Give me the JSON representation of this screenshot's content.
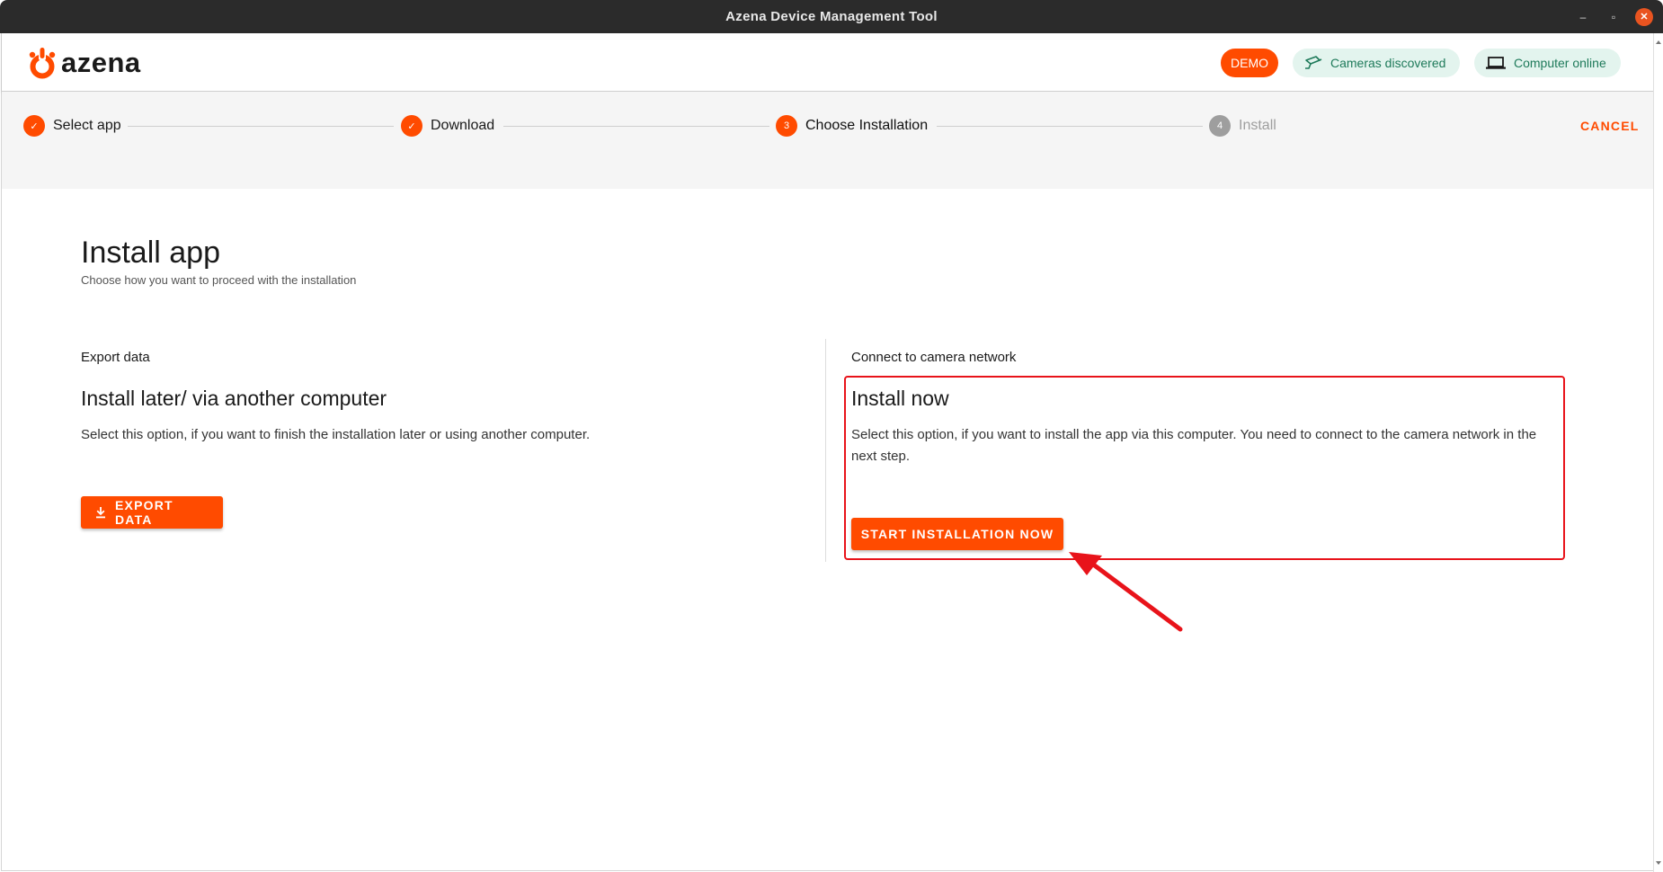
{
  "window": {
    "title": "Azena Device Management Tool",
    "minimize": "–",
    "maximize": "▫",
    "close": "✕"
  },
  "header": {
    "logo_text": "azena",
    "chips": {
      "demo": "DEMO",
      "cameras": "Cameras discovered",
      "computer": "Computer online"
    }
  },
  "stepper": {
    "steps": [
      {
        "label": "Select app",
        "state": "done",
        "marker": "✓"
      },
      {
        "label": "Download",
        "state": "done",
        "marker": "✓"
      },
      {
        "label": "Choose Installation",
        "state": "active",
        "marker": "3"
      },
      {
        "label": "Install",
        "state": "pending",
        "marker": "4"
      }
    ],
    "cancel_label": "CANCEL"
  },
  "page": {
    "title": "Install app",
    "subtitle": "Choose how you want to proceed with the installation"
  },
  "options": {
    "export": {
      "eyebrow": "Export data",
      "heading": "Install later/ via another computer",
      "description": "Select this option, if you want to finish the installation later or using another computer.",
      "button_label": "EXPORT DATA"
    },
    "install": {
      "eyebrow": "Connect to camera network",
      "heading": "Install now",
      "description": "Select this option, if you want to install the app via this computer. You need to connect to the camera network in the next step.",
      "button_label": "START INSTALLATION NOW"
    }
  },
  "colors": {
    "accent": "#ff4b00",
    "chip_bg": "#e3f4ee",
    "chip_text": "#1e7a5a",
    "annotation": "#e8131a"
  },
  "icons": {
    "logo": "azena-logo-icon",
    "cameras": "camera-icon",
    "computer": "laptop-icon",
    "export": "download-icon"
  }
}
